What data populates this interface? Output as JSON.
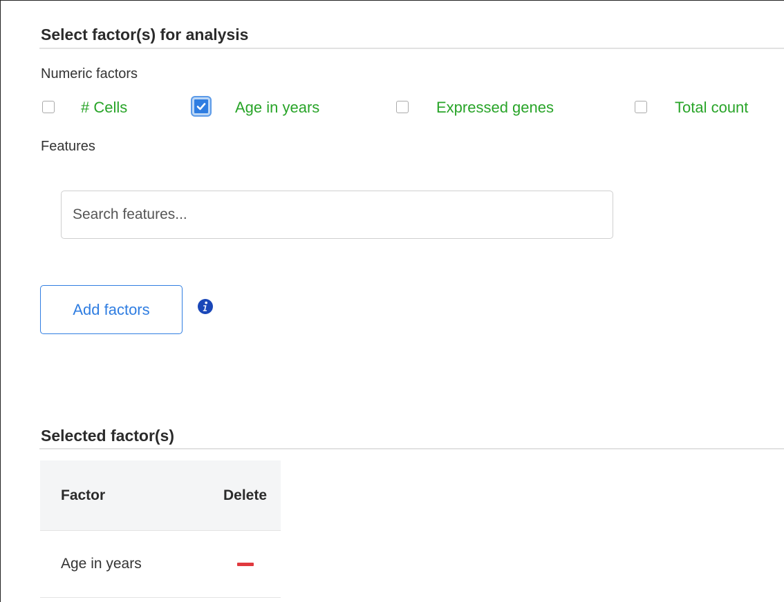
{
  "analysis": {
    "title": "Select factor(s) for analysis",
    "numeric_factors_label": "Numeric factors",
    "checkboxes": [
      {
        "label": "# Cells",
        "checked": false
      },
      {
        "label": "Age in years",
        "checked": true
      },
      {
        "label": "Expressed genes",
        "checked": false
      },
      {
        "label": "Total count",
        "checked": false
      }
    ],
    "features_label": "Features",
    "search_placeholder": "Search features...",
    "add_button": "Add factors",
    "info_icon": "info-circle-icon"
  },
  "selected": {
    "title": "Selected factor(s)",
    "columns": {
      "factor": "Factor",
      "delete": "Delete"
    },
    "rows": [
      {
        "factor": "Age in years",
        "delete_icon": "minus-icon"
      }
    ]
  },
  "colors": {
    "accent": "#2f7de1",
    "factor_label": "#28a428",
    "delete": "#e0393e"
  }
}
